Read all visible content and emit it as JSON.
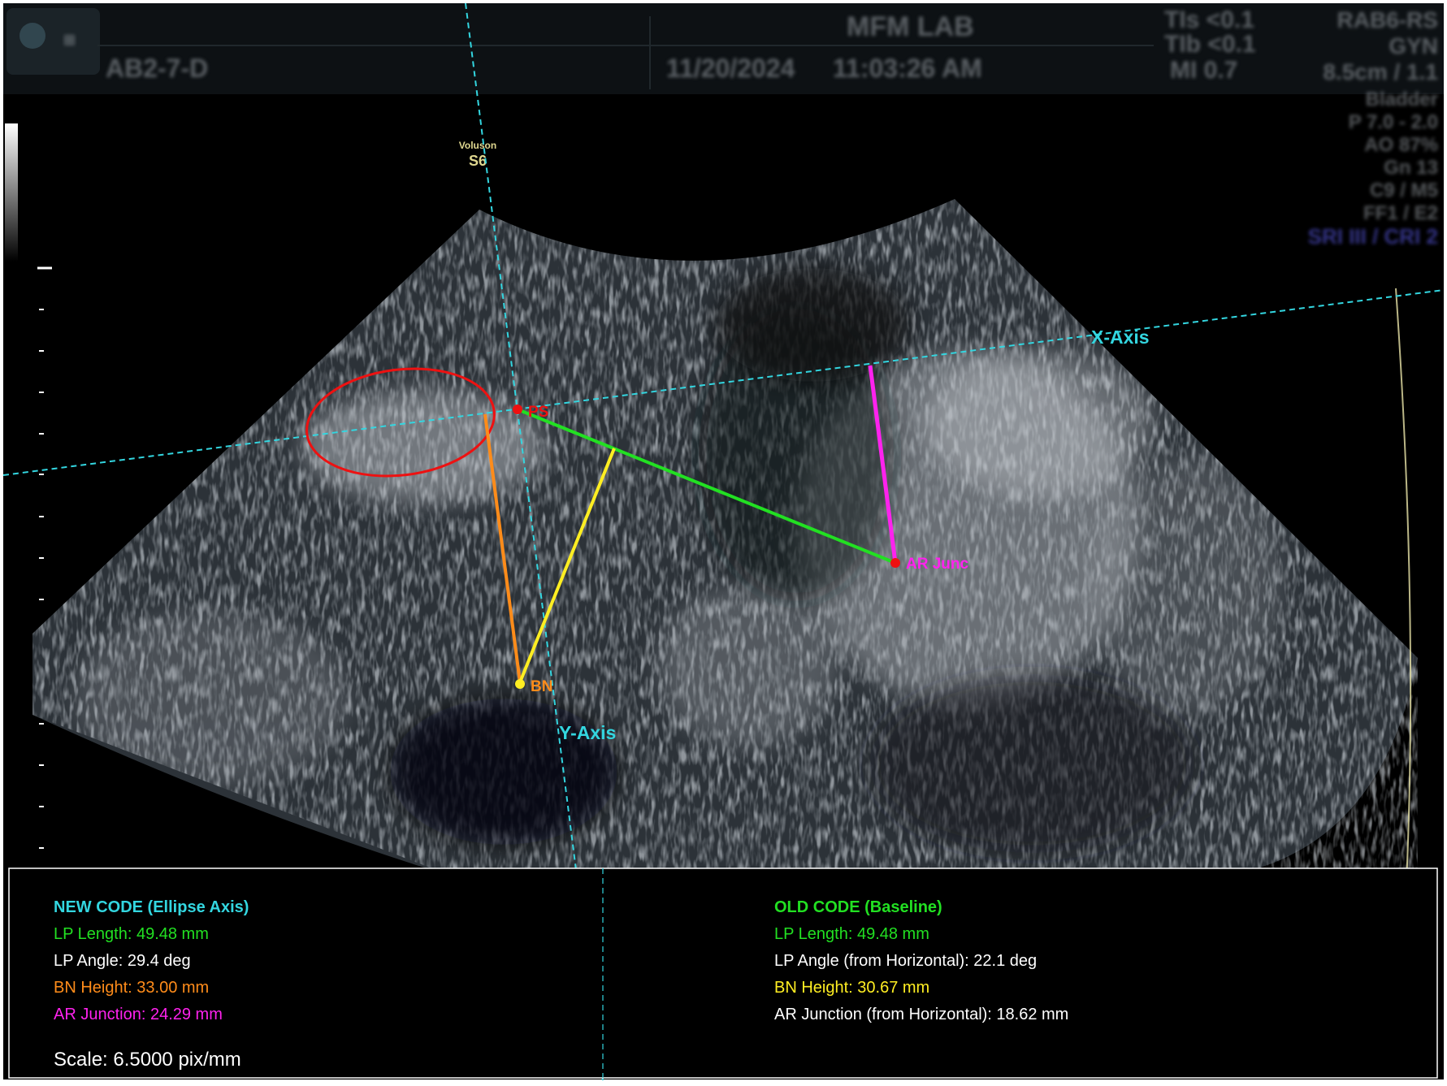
{
  "header": {
    "site_name": "MFM LAB",
    "probe": "AB2-7-D",
    "date": "11/20/2024",
    "time": "11:03:26 AM",
    "tis": "TIs <0.1",
    "tib": "TIb <0.1",
    "mi": "MI 0.7",
    "right_lines": [
      "RAB6-RS",
      "GYN",
      "8.5cm / 1.1",
      "Bladder",
      "P 7.0 - 2.0",
      "AO 87%",
      "Gn 13",
      "C9 / M5",
      "FF1 / E2",
      "SRI III / CRI 2"
    ]
  },
  "device": {
    "brand_line1": "Voluson",
    "brand_line2": "S6"
  },
  "overlay_labels": {
    "x_axis": "X-Axis",
    "y_axis": "Y-Axis",
    "ps": "PS",
    "bn": "BN",
    "ar_junc": "AR Junc"
  },
  "results": {
    "new": {
      "heading": "NEW CODE (Ellipse Axis)",
      "lp_length": "LP Length: 49.48 mm",
      "lp_angle": "LP Angle:  29.4 deg",
      "bn_height": "BN Height: 33.00 mm",
      "ar_junction": "AR Junction: 24.29 mm"
    },
    "old": {
      "heading": "OLD CODE (Baseline)",
      "lp_length": "LP Length: 49.48 mm",
      "lp_angle": "LP Angle (from Horizontal):  22.1 deg",
      "bn_height": "BN Height: 30.67 mm",
      "ar_junction": "AR Junction (from Horizontal): 18.62 mm"
    },
    "scale": "Scale: 6.5000 pix/mm"
  },
  "colors": {
    "cyan": "#33d6e0",
    "green": "#22e022",
    "orange": "#ff8c1a",
    "yellow": "#ffee22",
    "magenta": "#ff22ee",
    "red": "#ee1111",
    "white": "#ffffff"
  }
}
